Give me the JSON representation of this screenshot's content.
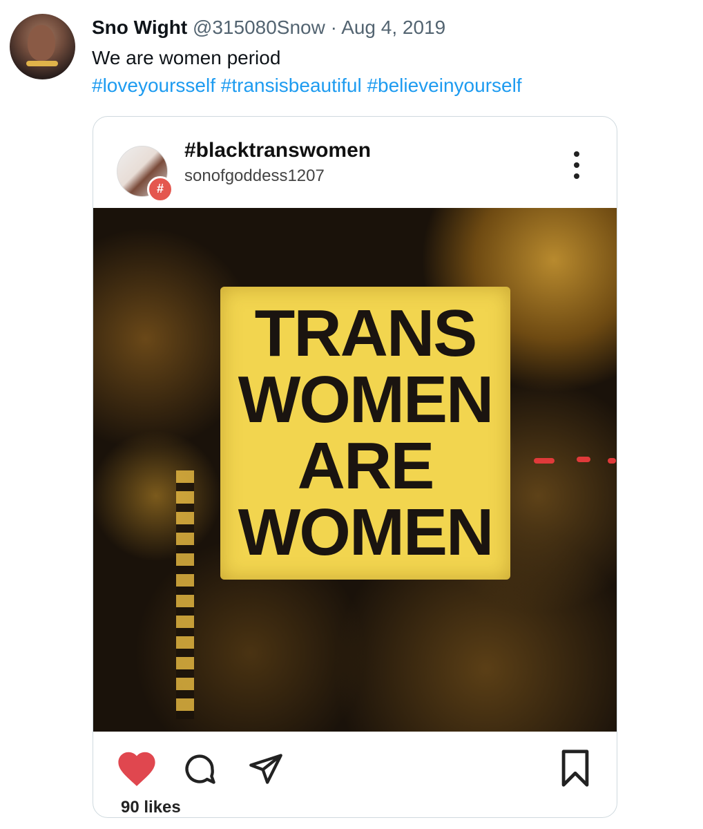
{
  "tweet": {
    "display_name": "Sno Wight",
    "handle": "@315080Snow",
    "separator": "·",
    "date": "Aug 4, 2019",
    "text": "We are women period",
    "hashtags": [
      "#loveyoursself",
      "#transisbeautiful",
      "#believeinyourself"
    ]
  },
  "embedded_post": {
    "title": "#blacktranswomen",
    "username": "sonofgoddess1207",
    "badge_symbol": "#",
    "sign_lines": [
      "TRANS",
      "WOMEN",
      "ARE",
      "WOMEN"
    ],
    "likes_text": "90 likes"
  },
  "icons": {
    "heart": "heart-icon",
    "comment": "comment-icon",
    "share": "send-icon",
    "bookmark": "bookmark-icon",
    "more": "more-vertical-icon"
  },
  "colors": {
    "link": "#1d9bf0",
    "heart": "#e0474f",
    "sign": "#f2d54f"
  }
}
